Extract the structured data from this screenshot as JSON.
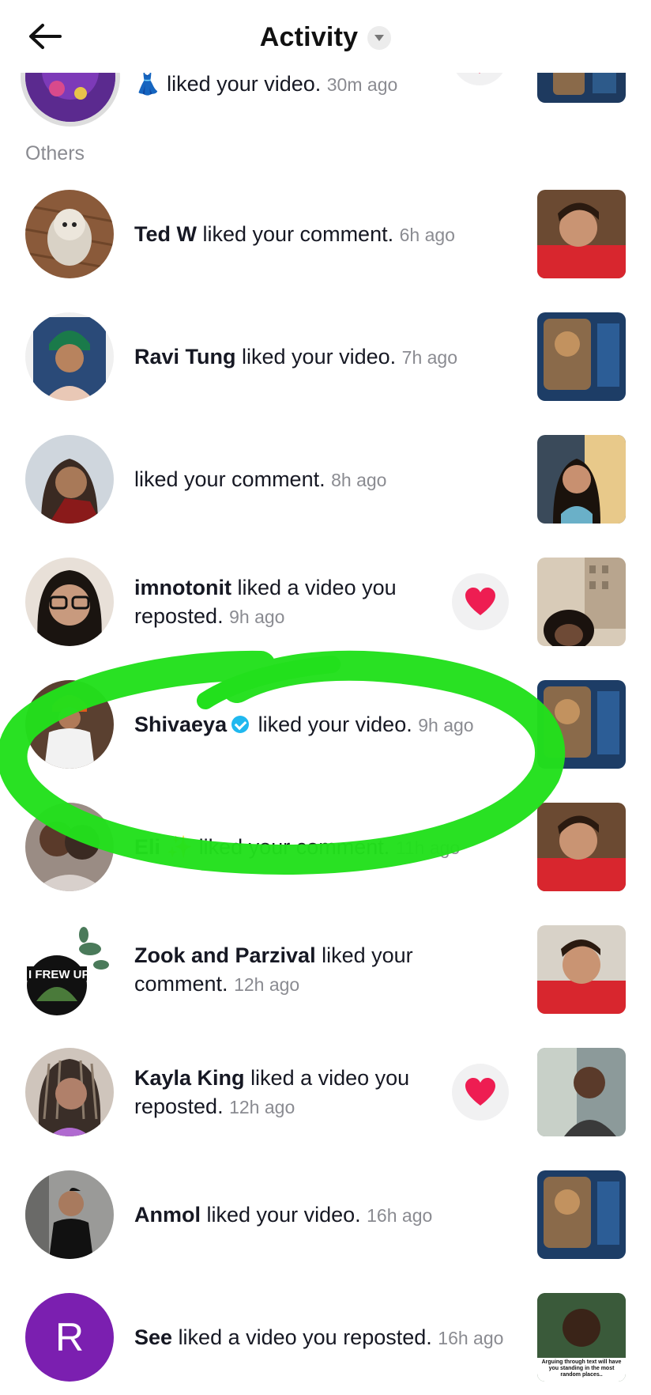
{
  "header": {
    "title": "Activity",
    "back_icon": "arrow-left-icon",
    "caret_icon": "caret-down-icon"
  },
  "top_partial": {
    "emoji": "👗",
    "text": "liked your video.",
    "time": "30m ago"
  },
  "section_label": "Others",
  "notifications": [
    {
      "name": "Ted W",
      "action": "liked your comment.",
      "time": "6h ago"
    },
    {
      "name": "Ravi Tung",
      "action": "liked your video.",
      "time": "7h ago"
    },
    {
      "name": "",
      "action": "liked your comment.",
      "time": "8h ago"
    },
    {
      "name": "imnotonit",
      "action": "liked a video you reposted.",
      "time": "9h ago"
    },
    {
      "name": "Shivaeya",
      "action": "liked your video.",
      "time": "9h ago"
    },
    {
      "name": "Eli ✨",
      "action": "liked your comment.",
      "time": "11h ago"
    },
    {
      "name": "Zook and Parzival",
      "action": "liked your comment.",
      "time": "12h ago"
    },
    {
      "name": "Kayla King",
      "action": "liked a video you reposted.",
      "time": "12h ago"
    },
    {
      "name": "Anmol",
      "action": "liked your video.",
      "time": "16h ago"
    },
    {
      "name": "See",
      "action": "liked a video you reposted.",
      "time": "16h ago"
    }
  ],
  "avatar_texts": {
    "zook": "I FREW UP",
    "see_initial": "R"
  },
  "thumb_caption": "Arguing through text will have you standing in the most random places..",
  "colors": {
    "heart": "#ee1d52",
    "verified": "#20b8ef",
    "highlight": "#22e01c",
    "avatar_r": "#7b1fb0"
  }
}
